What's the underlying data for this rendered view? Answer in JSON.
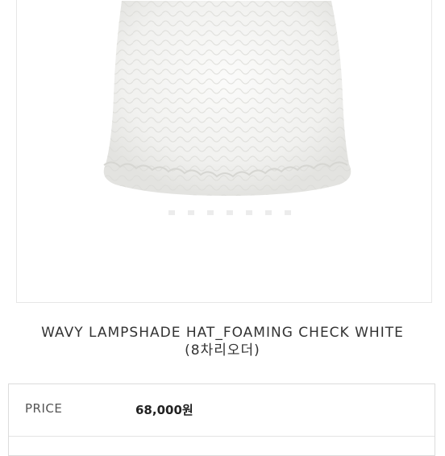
{
  "product": {
    "image_alt": "white wavy lampshade bucket hat",
    "title_line1": "WAVY LAMPSHADE HAT_FOAMING CHECK WHITE",
    "title_line2": "(8차리오더)"
  },
  "price": {
    "label": "PRICE",
    "value": "68,000원"
  }
}
